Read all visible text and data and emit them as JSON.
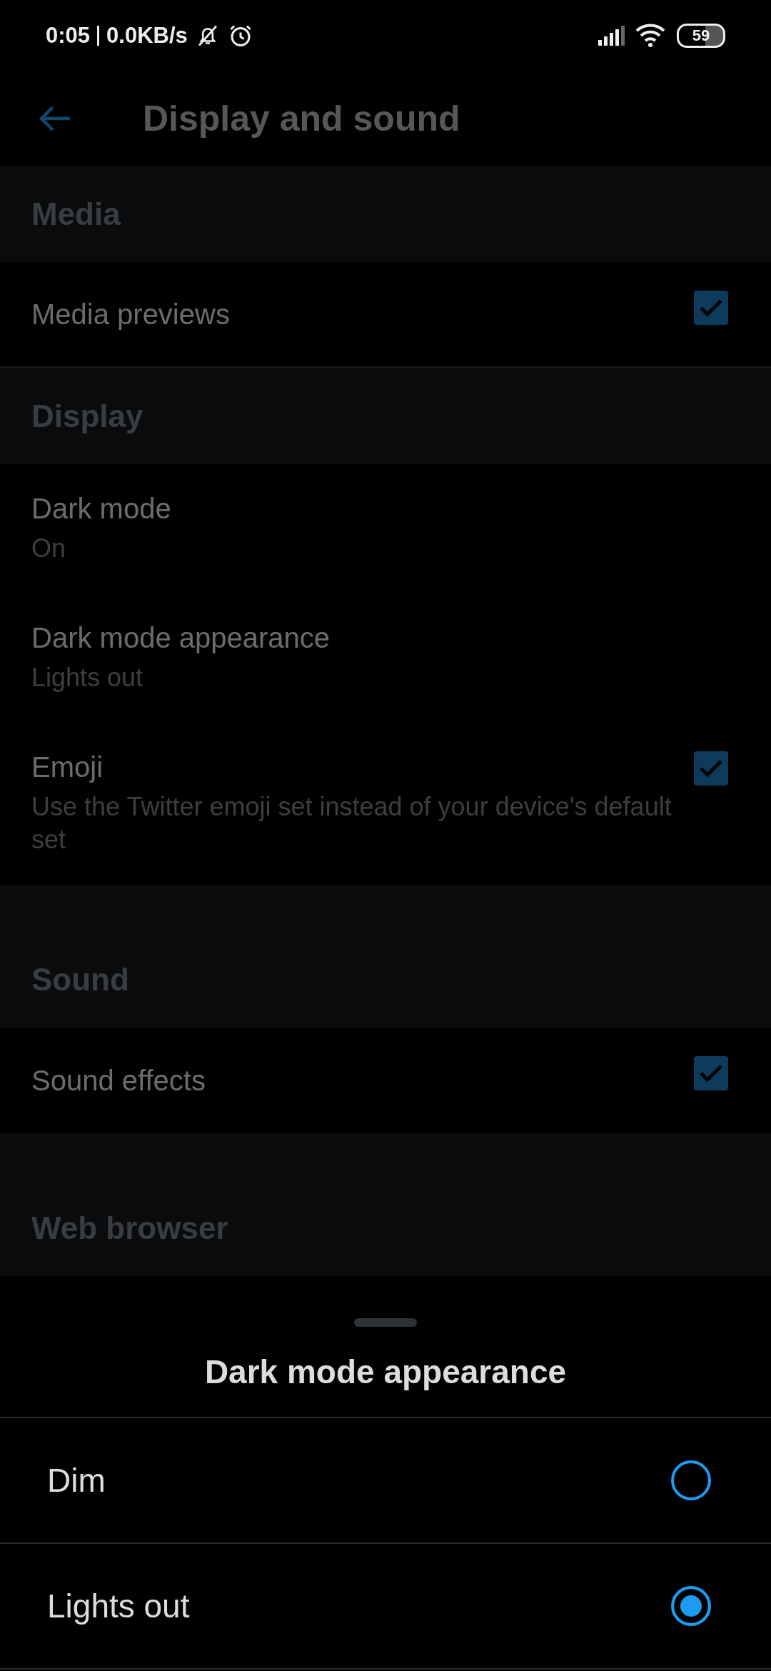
{
  "status_bar": {
    "time": "0:05",
    "speed": "0.0KB/s",
    "battery": "59"
  },
  "app_bar": {
    "title": "Display and sound"
  },
  "sections": [
    {
      "header": "Media",
      "items": [
        {
          "kind": "checkbox",
          "title": "Media previews",
          "checked": true
        }
      ]
    },
    {
      "header": "Display",
      "items": [
        {
          "kind": "text",
          "title": "Dark mode",
          "subtitle": "On"
        },
        {
          "kind": "text",
          "title": "Dark mode appearance",
          "subtitle": "Lights out"
        },
        {
          "kind": "checkbox",
          "title": "Emoji",
          "subtitle": "Use the Twitter emoji set instead of your device's default set",
          "checked": true
        }
      ]
    },
    {
      "header": "Sound",
      "items": [
        {
          "kind": "checkbox",
          "title": "Sound effects",
          "checked": true
        }
      ]
    },
    {
      "header": "Web browser"
    }
  ],
  "sheet": {
    "title": "Dark mode appearance",
    "options": [
      {
        "label": "Dim",
        "selected": false
      },
      {
        "label": "Lights out",
        "selected": true
      }
    ]
  }
}
